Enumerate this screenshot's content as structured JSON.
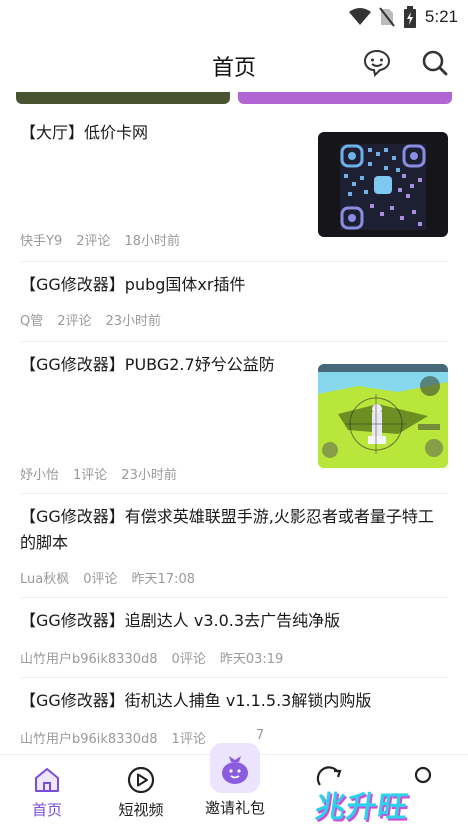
{
  "status_bar": {
    "time": "5:21"
  },
  "header": {
    "title": "首页"
  },
  "posts": [
    {
      "title": "【大厅】低价卡网",
      "author": "快手Y9",
      "comments": "2评论",
      "time": "18小时前"
    },
    {
      "title": "【GG修改器】pubg国体xr插件",
      "author": "Q管",
      "comments": "2评论",
      "time": "23小时前"
    },
    {
      "title": "【GG修改器】PUBG2.7妤兮公益防",
      "author": "妤小怡",
      "comments": "1评论",
      "time": "23小时前"
    },
    {
      "title": "【GG修改器】有偿求英雄联盟手游,火影忍者或者量子特工的脚本",
      "author": "Lua秋枫",
      "comments": "0评论",
      "time": "昨天17:08"
    },
    {
      "title": "【GG修改器】追剧达人 v3.0.3去广告纯净版",
      "author": "山竹用户b96ik8330d8",
      "comments": "0评论",
      "time": "昨天03:19"
    },
    {
      "title": "【GG修改器】街机达人捕鱼 v1.1.5.3解锁内购版",
      "author": "山竹用户b96ik8330d8",
      "comments": "1评论",
      "time": "7"
    }
  ],
  "bottom_nav": {
    "home": "首页",
    "short_video": "短视频",
    "invite": "邀请礼包"
  },
  "watermark": "兆升旺",
  "colors": {
    "accent": "#7a4dd8",
    "banner_left": "#4a5330",
    "banner_right": "#b164d4"
  }
}
